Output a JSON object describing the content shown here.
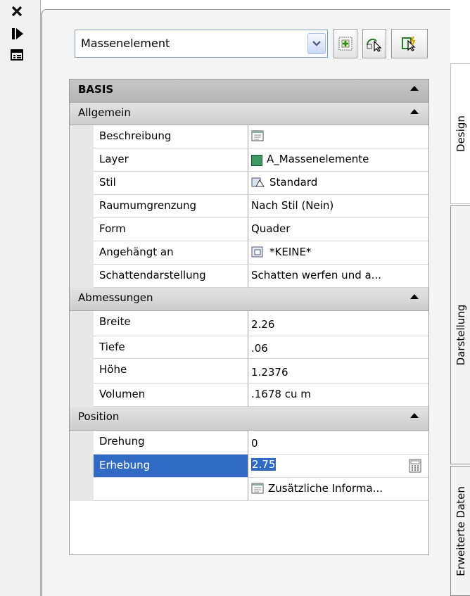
{
  "left_strip": {
    "icons": [
      "close-icon",
      "auto-hide-icon",
      "properties-menu-icon"
    ]
  },
  "combo": {
    "value": "Massenelement"
  },
  "toolbar": {
    "buttons": [
      "add-selection-icon",
      "quick-select-icon",
      "toggle-pickadd-icon"
    ]
  },
  "sections": {
    "basis": {
      "label": "BASIS"
    },
    "allgemein": {
      "label": "Allgemein"
    },
    "abmessungen": {
      "label": "Abmessungen"
    },
    "position": {
      "label": "Position"
    }
  },
  "allgemein_rows": [
    {
      "name": "Beschreibung",
      "value": ""
    },
    {
      "name": "Layer",
      "value": "A_Massenelemente"
    },
    {
      "name": "Stil",
      "value": "Standard"
    },
    {
      "name": "Raumumgrenzung",
      "value": "Nach Stil (Nein)"
    },
    {
      "name": "Form",
      "value": "Quader"
    },
    {
      "name": "Angehängt an",
      "value": "*KEINE*"
    },
    {
      "name": "Schattendarstellung",
      "value": "Schatten werfen und a..."
    }
  ],
  "abmessungen_rows": [
    {
      "name": "Breite",
      "value": "2.26"
    },
    {
      "name": "Tiefe",
      "value": ".06"
    },
    {
      "name": "Höhe",
      "value": "1.2376"
    },
    {
      "name": "Volumen",
      "value": ".1678  cu m"
    }
  ],
  "position_rows": [
    {
      "name": "Drehung",
      "value": "0"
    },
    {
      "name": "Erhebung",
      "value": "2.75"
    },
    {
      "name": "",
      "value": "Zusätzliche Informa..."
    }
  ],
  "tabs": [
    "Design",
    "Darstellung",
    "Erweiterte Daten"
  ],
  "colors": {
    "selection": "#316ac5",
    "layer_swatch": "#3c9a64"
  }
}
